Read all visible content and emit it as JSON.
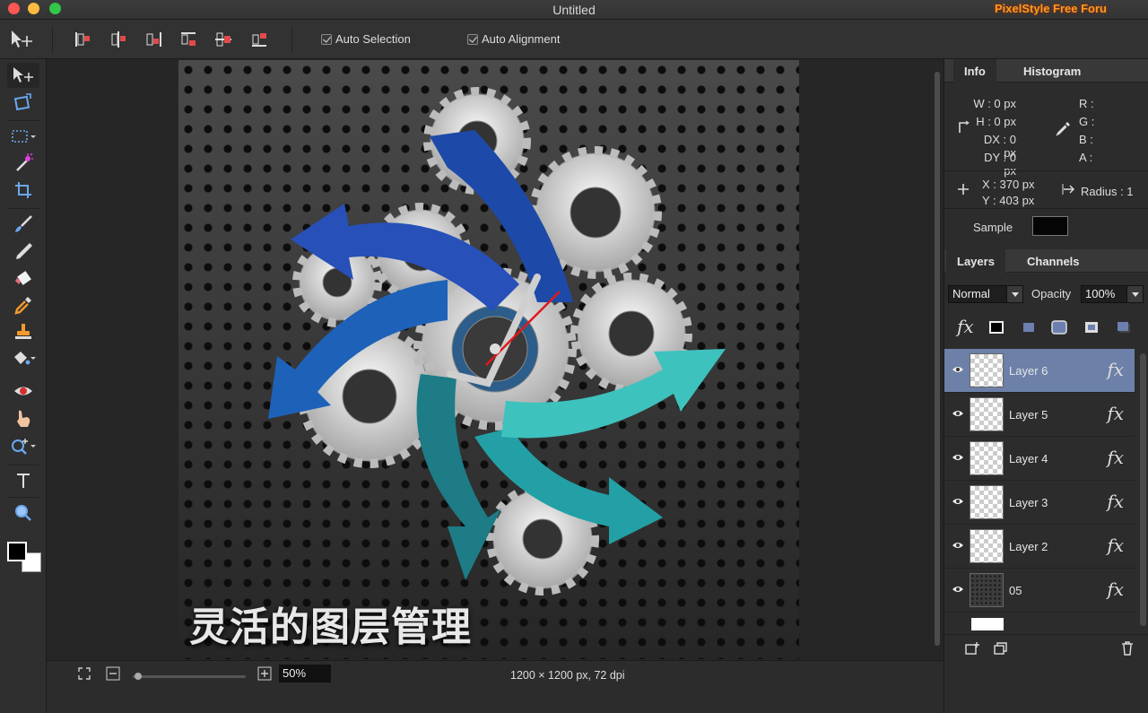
{
  "window": {
    "title": "Untitled",
    "brand": "PixelStyle Free Foru"
  },
  "toolbar": {
    "auto_selection": "Auto Selection",
    "auto_alignment": "Auto Alignment"
  },
  "canvas": {
    "caption": "灵活的图层管理"
  },
  "status": {
    "zoom": "50%",
    "doc_info": "1200 × 1200 px, 72 dpi"
  },
  "info_panel": {
    "tab_info": "Info",
    "tab_histogram": "Histogram",
    "w": "W :  0 px",
    "h": "H :  0 px",
    "dx": "DX :  0 px",
    "dy": "DY :  0 px",
    "r": "R :",
    "g": "G :",
    "b": "B :",
    "a": "A :",
    "x": "X :  370 px",
    "y": "Y :  403 px",
    "radius": "Radius :  1",
    "sample": "Sample"
  },
  "layers_panel": {
    "tab_layers": "Layers",
    "tab_channels": "Channels",
    "blend_mode": "Normal",
    "opacity_label": "Opacity",
    "opacity_value": "100%",
    "fx": "fx",
    "layers": [
      {
        "name": "Layer 6",
        "selected": true
      },
      {
        "name": "Layer 5",
        "selected": false
      },
      {
        "name": "Layer 4",
        "selected": false
      },
      {
        "name": "Layer 3",
        "selected": false
      },
      {
        "name": "Layer 2",
        "selected": false
      },
      {
        "name": "05",
        "selected": false
      }
    ]
  },
  "colors": {
    "accent_selected_layer": "#6c80a8",
    "brand": "#ff9a1e"
  }
}
